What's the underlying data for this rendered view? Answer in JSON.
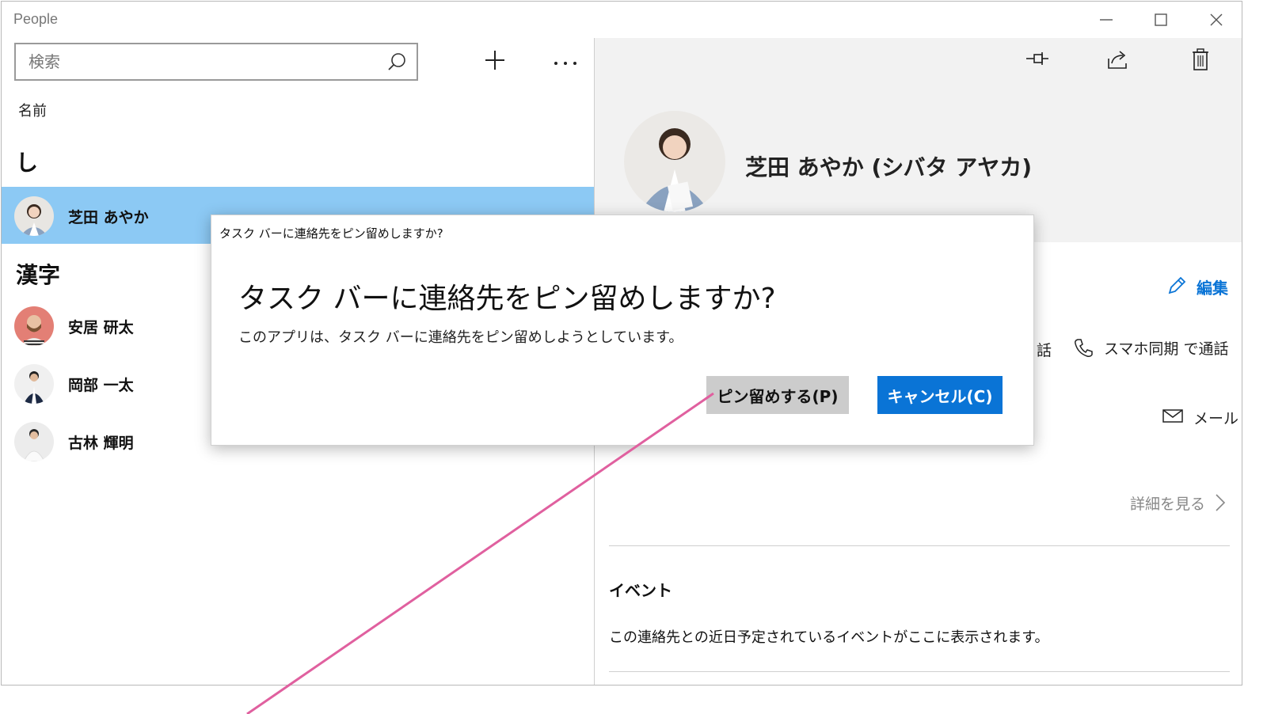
{
  "app": {
    "title": "People"
  },
  "window_controls": [
    "minimize-icon",
    "maximize-icon",
    "close-icon"
  ],
  "left_pane": {
    "search": {
      "placeholder": "検索"
    },
    "sort_label": "名前",
    "groups": [
      {
        "header": "し",
        "contacts": [
          {
            "name": "芝田 あやか",
            "selected": true
          }
        ]
      },
      {
        "header": "漢字",
        "contacts": [
          {
            "name": "安居 研太",
            "selected": false
          },
          {
            "name": "岡部 一太",
            "selected": false
          },
          {
            "name": "古林 輝明",
            "selected": false
          }
        ]
      }
    ]
  },
  "right_pane": {
    "toolbar": [
      "pin-icon",
      "share-icon",
      "trash-icon"
    ],
    "contact": {
      "full_name": "芝田 あやか (シバタ アヤカ)"
    },
    "edit_label": "編集",
    "partial_call_label": "話",
    "call_label": "スマホ同期 で通話",
    "mail_label": "メール",
    "details_label": "詳細を見る",
    "events": {
      "title": "イベント",
      "empty_text": "この連絡先との近日予定されているイベントがここに表示されます。"
    }
  },
  "dialog": {
    "caption": "タスク バーに連絡先をピン留めしますか?",
    "heading": "タスク バーに連絡先をピン留めしますか?",
    "body": "このアプリは、タスク バーに連絡先をピン留めしようとしています。",
    "pin_button": "ピン留めする(P)",
    "cancel_button": "キャンセル(C)"
  },
  "colors": {
    "selection": "#8cc9f4",
    "accent": "#0a74d6",
    "annotation_line": "#e0609f"
  }
}
